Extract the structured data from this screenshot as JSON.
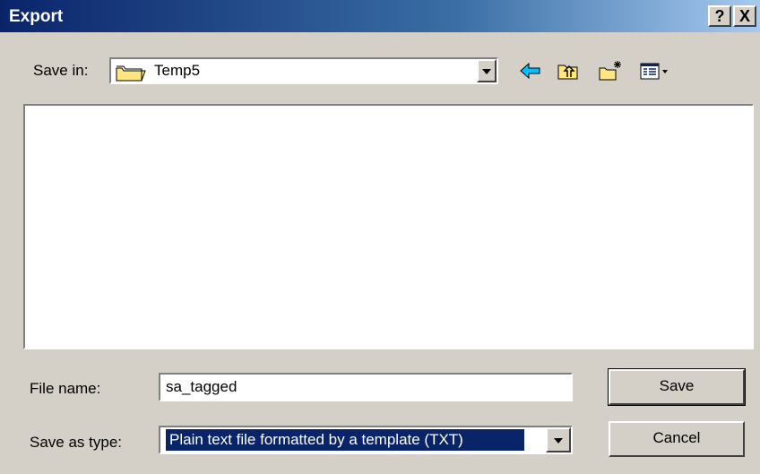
{
  "window": {
    "title": "Export",
    "help_label": "?",
    "close_label": "X"
  },
  "toolbar": {
    "save_in_label": "Save in:",
    "save_in_value": "Temp5",
    "icons": [
      "back-arrow-icon",
      "up-one-level-icon",
      "create-new-folder-icon",
      "views-menu-icon"
    ]
  },
  "file_list": {
    "items": []
  },
  "form": {
    "file_name_label": "File name:",
    "file_name_value": "sa_tagged",
    "save_as_type_label": "Save as type:",
    "save_as_type_value": "Plain text file formatted by a template (TXT)"
  },
  "buttons": {
    "save_label": "Save",
    "cancel_label": "Cancel"
  },
  "colors": {
    "title_gradient_start": "#0a246a",
    "title_gradient_end": "#a6caf0",
    "dialog_face": "#d4d0c8",
    "selection": "#0a246a"
  }
}
